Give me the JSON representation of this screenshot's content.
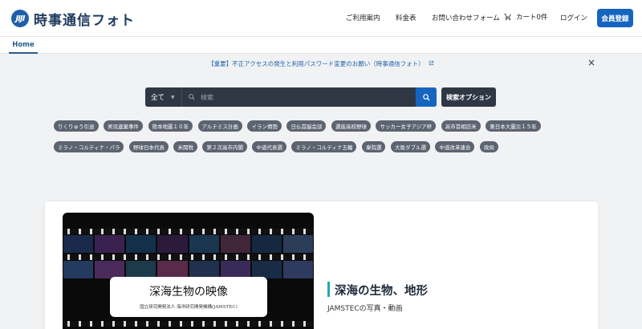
{
  "header": {
    "logo_mark": "JIJI",
    "logo_text": "時事通信フォト",
    "nav": [
      "ご利用案内",
      "料金表",
      "お問い合わせフォーム"
    ],
    "cart_label": "カート0件",
    "login": "ログイン",
    "signup": "会員登録"
  },
  "tabs": {
    "home": "Home"
  },
  "notice": {
    "text": "【重要】不正アクセスの発生と利用パスワード変更のお願い（時事通信フォト）",
    "close": "×"
  },
  "search": {
    "scope": "全て",
    "placeholder": "検索",
    "options_label": "検索オプション"
  },
  "tags": [
    [
      "りくりゅう引退",
      "男児遺棄事件",
      "熊本地震１０年",
      "アルテミス計画",
      "イラン情勢",
      "日仏首脳会談",
      "選抜高校野球",
      "サッカー女子アジア杯",
      "高市首相訪米",
      "東日本大震災１５年"
    ],
    [
      "ミラノ・コルティナ・パラ",
      "野球日本代表",
      "米関税",
      "第２次高市内閣",
      "中道代表選",
      "ミラノ・コルティナ五輪",
      "衆院選",
      "大阪ダブル選",
      "中道改革連合",
      "政局"
    ]
  ],
  "feature": {
    "image_title": "深海生物の映像",
    "image_subtitle": "国立研究開発法人 海洋研究開発機構(JAMSTEC)",
    "title": "深海の生物、地形",
    "subtitle": "JAMSTECの写真・動画"
  },
  "colors": {
    "brand": "#1565c0",
    "dark": "#2f3745",
    "tag": "#5c6470",
    "accent": "#2aa3b8"
  }
}
